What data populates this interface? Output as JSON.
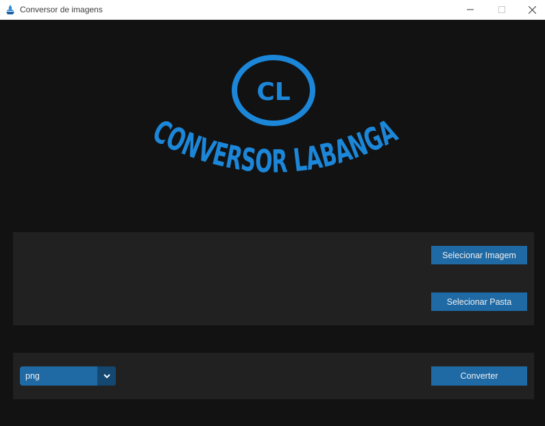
{
  "window": {
    "title": "Conversor de imagens"
  },
  "logo": {
    "monogram": "CL",
    "wordmark": "CONVERSOR LABANGA",
    "color": "#1c86d8"
  },
  "select_panel": {
    "select_image_label": "Selecionar Imagem",
    "select_folder_label": "Selecionar Pasta"
  },
  "convert_panel": {
    "format_value": "png",
    "convert_label": "Converter"
  },
  "colors": {
    "background": "#121212",
    "panel": "#212121",
    "button": "#1f6aa5",
    "dropdown_arrow_bg": "#144870"
  }
}
